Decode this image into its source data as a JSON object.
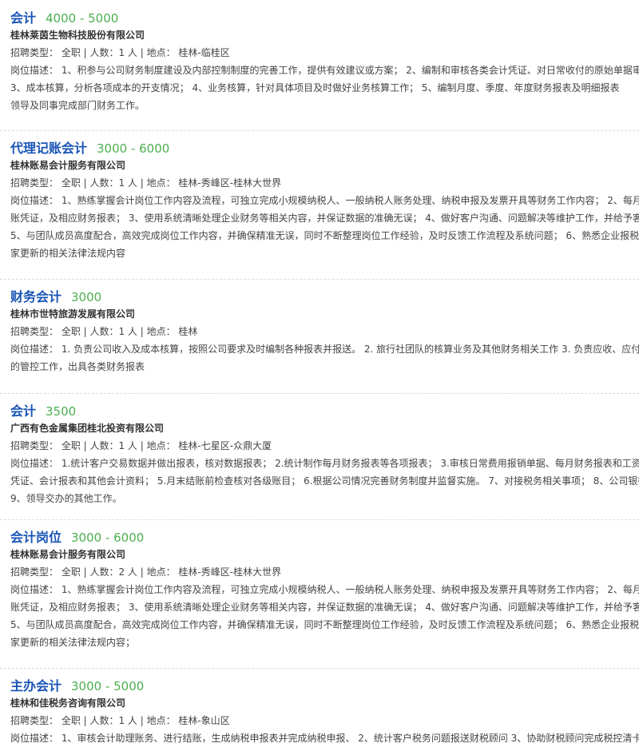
{
  "jobs": [
    {
      "title": "会计",
      "salary": "4000 - 5000",
      "company": "桂林莱茵生物科技股份有限公司",
      "meta": "招聘类型： 全职 | 人数：1 人 | 地点： 桂林-临桂区",
      "desc_lines": [
        "岗位描述： 1、积参与公司财务制度建设及内部控制制度的完善工作，提供有效建议或方案； 2、编制和审核各类会计凭证、对日常收付的原始单据审",
        "3、成本核算，分析各项成本的开支情况； 4、业务核算，针对具体项目及时做好业务核算工作； 5、编制月度、季度、年度财务报表及明细报表",
        "领导及同事完成部门财务工作。"
      ]
    },
    {
      "title": "代理记账会计",
      "salary": "3000 - 6000",
      "company": "桂林账易会计服务有限公司",
      "meta": "招聘类型： 全职 | 人数：1 人 | 地点： 桂林-秀峰区-桂林大世界",
      "desc_lines": [
        "岗位描述： 1、熟练掌握会计岗位工作内容及流程，可独立完成小规模纳税人、一般纳税人账务处理、纳税申报及发票开具等财务工作内容； 2、每月",
        "账凭证，及相应财务报表； 3、使用系统清晰处理企业财务等相关内容，并保证数据的准确无误； 4、做好客户沟通、问题解决等维护工作，并给予客",
        "5、与团队成员高度配合，高效完成岗位工作内容，并确保精准无误，同时不断整理岗位工作经验，及时反馈工作流程及系统问题； 6、熟悉企业报税",
        "家更新的相关法律法规内容"
      ]
    },
    {
      "title": "财务会计",
      "salary": "3000",
      "company": "桂林市世特旅游发展有限公司",
      "meta": "招聘类型： 全职 | 人数：1 人 | 地点： 桂林",
      "desc_lines": [
        "岗位描述： 1. 负责公司收入及成本核算，按照公司要求及时编制各种报表并报送。 2. 旅行社团队的核算业务及其他财务相关工作 3. 负责应收、应付账",
        "的管控工作，出具各类财务报表"
      ]
    },
    {
      "title": "会计",
      "salary": "3500",
      "company": "广西有色金属集团桂北投资有限公司",
      "meta": "招聘类型： 全职 | 人数：1 人 | 地点： 桂林-七星区-众鼎大厦",
      "desc_lines": [
        "岗位描述： 1.统计客户交易数据并做出报表，核对数据报表； 2.统计制作每月财务报表等各项报表； 3.审核日常费用报销单据、每月财务报表和工资表",
        "凭证、会计报表和其他会计资料； 5.月末结账前检查核对各级账目； 6.根据公司情况完善财务制度并监督实施。 7、对接税务相关事项； 8、公司银行",
        "9、领导交办的其他工作。"
      ]
    },
    {
      "title": "会计岗位",
      "salary": "3000 - 6000",
      "company": "桂林账易会计服务有限公司",
      "meta": "招聘类型： 全职 | 人数：2 人 | 地点： 桂林-秀峰区-桂林大世界",
      "desc_lines": [
        "岗位描述： 1、熟练掌握会计岗位工作内容及流程，可独立完成小规模纳税人、一般纳税人账务处理、纳税申报及发票开具等财务工作内容； 2、每月",
        "账凭证，及相应财务报表； 3、使用系统清晰处理企业财务等相关内容，并保证数据的准确无误； 4、做好客户沟通、问题解决等维护工作，并给予客",
        "5、与团队成员高度配合，高效完成岗位工作内容，并确保精准无误，同时不断整理岗位工作经验，及时反馈工作流程及系统问题； 6、熟悉企业报税",
        "家更新的相关法律法规内容；"
      ]
    },
    {
      "title": "主办会计",
      "salary": "3000 - 5000",
      "company": "桂林和佳税务咨询有限公司",
      "meta": "招聘类型： 全职 | 人数：1 人 | 地点： 桂林-象山区",
      "desc_lines": [
        "岗位描述： 1、审核会计助理账务、进行结账，生成纳税申报表并完成纳税申报、 2、统计客户税务问题报送财税顾问 3、协助财税顾问完成税控清卡"
      ]
    }
  ]
}
